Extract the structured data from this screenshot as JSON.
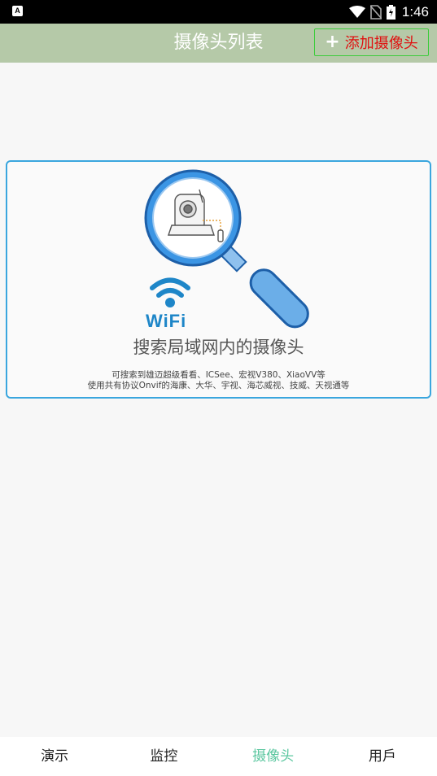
{
  "status_bar": {
    "notification_icon": "a-icon",
    "time": "1:46"
  },
  "header": {
    "title": "摄像头列表",
    "add_button": "添加摄像头",
    "add_icon": "plus-icon"
  },
  "search_card": {
    "wifi_label": "WiFi",
    "title": "搜索局域网内的摄像头",
    "desc_line1": "可搜索到雄迈超级看看、ICSee、宏视V380、XiaoVV等",
    "desc_line2": "使用共有协议Onvif的海康、大华、宇视、海芯威视、技威、天视通等"
  },
  "tabs": [
    {
      "label": "演示"
    },
    {
      "label": "监控"
    },
    {
      "label": "摄像头"
    },
    {
      "label": "用戶"
    }
  ],
  "colors": {
    "header_bg": "#b5c9a8",
    "accent_blue": "#3aa6de",
    "active_tab": "#5cc7a0",
    "add_label": "#e01010"
  }
}
